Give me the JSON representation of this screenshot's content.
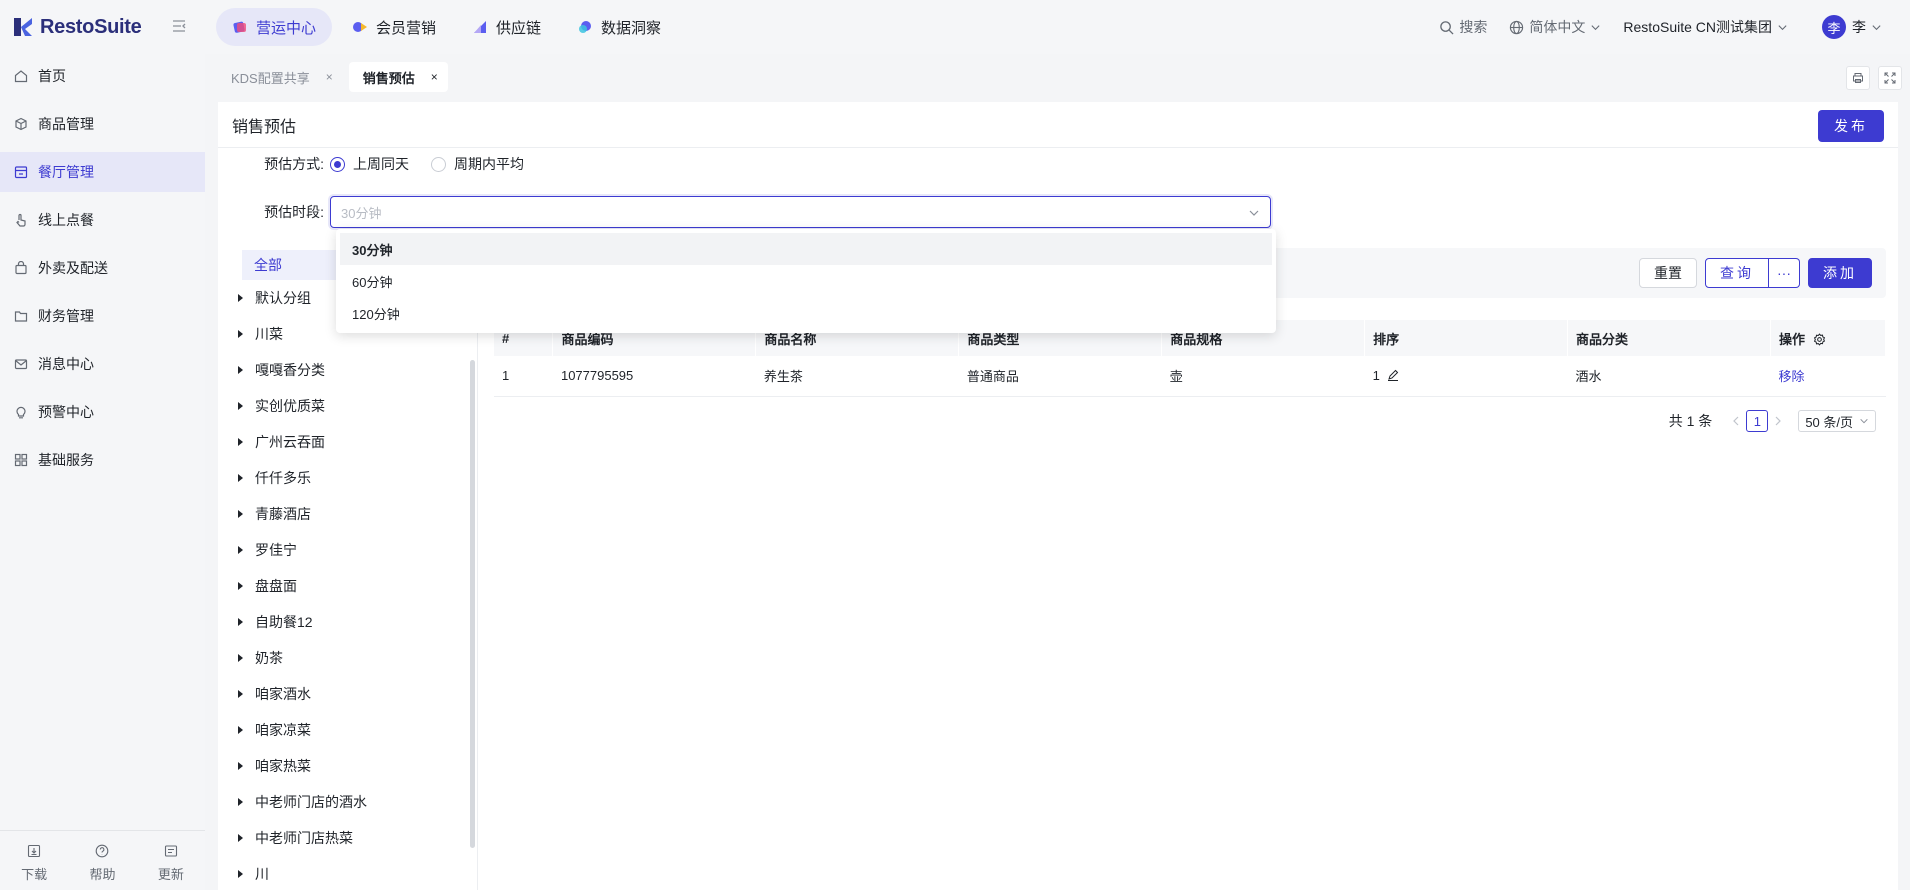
{
  "app": {
    "brand": "RestoSuite"
  },
  "topnav": [
    {
      "label": "营运中心",
      "active": true
    },
    {
      "label": "会员营销"
    },
    {
      "label": "供应链"
    },
    {
      "label": "数据洞察"
    }
  ],
  "topright": {
    "search": "搜索",
    "language": "简体中文",
    "company": "RestoSuite CN测试集团",
    "avatar": "李",
    "user": "李"
  },
  "sidebar": {
    "items": [
      {
        "label": "首页"
      },
      {
        "label": "商品管理"
      },
      {
        "label": "餐厅管理",
        "active": true
      },
      {
        "label": "线上点餐"
      },
      {
        "label": "外卖及配送"
      },
      {
        "label": "财务管理"
      },
      {
        "label": "消息中心"
      },
      {
        "label": "预警中心"
      },
      {
        "label": "基础服务"
      }
    ],
    "bottom": [
      {
        "label": "下载"
      },
      {
        "label": "帮助"
      },
      {
        "label": "更新"
      }
    ]
  },
  "tabs": [
    {
      "label": "KDS配置共享",
      "close": "×"
    },
    {
      "label": "销售预估",
      "close": "×",
      "active": true
    }
  ],
  "page": {
    "title": "销售预估",
    "publish": "发布",
    "method_label": "预估方式:",
    "method_options": [
      "上周同天",
      "周期内平均"
    ],
    "period_label": "预估时段:",
    "period_placeholder": "30分钟",
    "period_options": [
      "30分钟",
      "60分钟",
      "120分钟"
    ]
  },
  "tree": {
    "all": "全部",
    "items": [
      "默认分组",
      "川菜",
      "嘎嘎香分类",
      "实创优质菜",
      "广州云吞面",
      "仟仟多乐",
      "青藤酒店",
      "罗佳宁",
      "盘盘面",
      "自助餐12",
      "奶茶",
      "咱家酒水",
      "咱家凉菜",
      "咱家热菜",
      "中老师门店的酒水",
      "中老师门店热菜",
      "川"
    ]
  },
  "toolbar": {
    "reset": "重置",
    "query": "查询",
    "more": "···",
    "add": "添加"
  },
  "table": {
    "headers": [
      "#",
      "商品编码",
      "商品名称",
      "商品类型",
      "商品规格",
      "排序",
      "商品分类",
      "操作"
    ],
    "rows": [
      {
        "idx": "1",
        "code": "1077795595",
        "name": "养生茶",
        "type": "普通商品",
        "spec": "壶",
        "sort": "1",
        "category": "酒水",
        "action": "移除"
      }
    ]
  },
  "pager": {
    "total": "共 1 条",
    "page": "1",
    "size": "50 条/页"
  },
  "colors": {
    "accent": "#3d3bd1",
    "accent_light": "#e6e7f8"
  }
}
